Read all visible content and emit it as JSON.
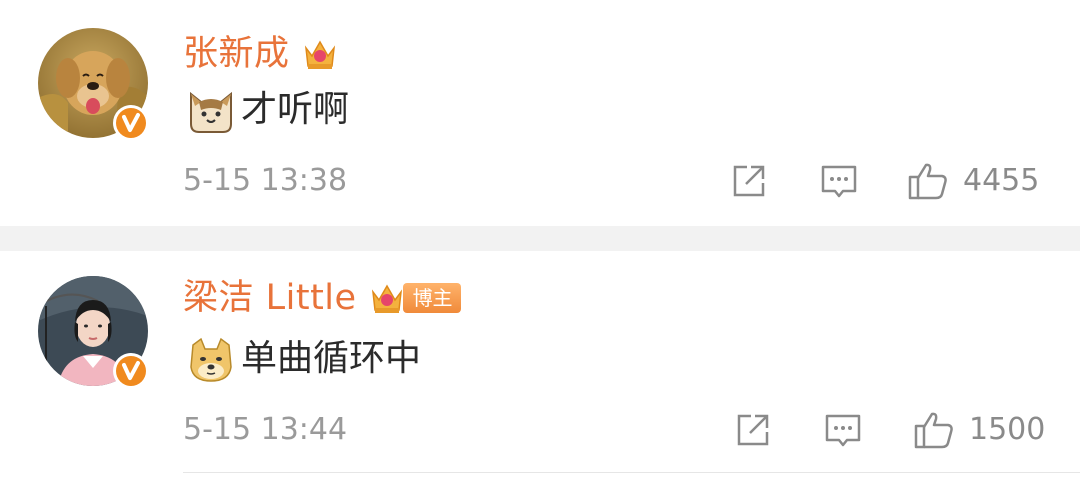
{
  "comments": [
    {
      "username": "张新成",
      "badge": "",
      "content": "才听啊",
      "emoji": "cat-emoji",
      "timestamp": "5-15 13:38",
      "like_count": "4455",
      "avatar": "golden-retriever-avatar"
    },
    {
      "username": "梁洁 Little",
      "badge": "博主",
      "content": "单曲循环中",
      "emoji": "doge-emoji",
      "timestamp": "5-15 13:44",
      "like_count": "1500",
      "avatar": "woman-portrait-avatar"
    }
  ],
  "colors": {
    "username": "#e8733a",
    "text": "#2b2b2b",
    "meta": "#9a9a9a",
    "separator": "#f2f2f2",
    "verified_badge": "#f08a1e"
  }
}
